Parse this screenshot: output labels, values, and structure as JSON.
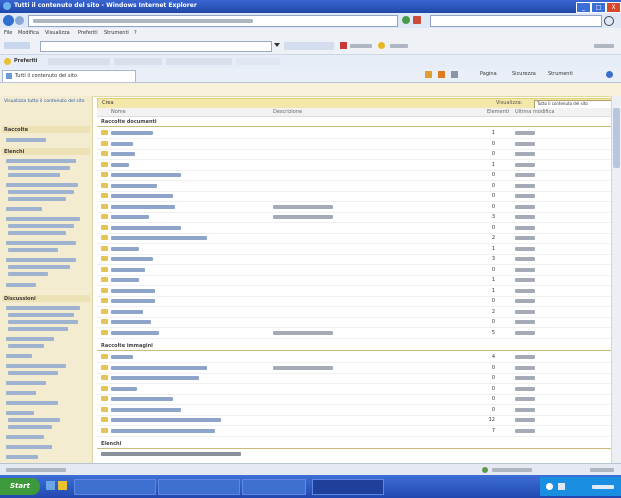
{
  "window": {
    "title": "Tutti il contenuto del sito - Windows Internet Explorer",
    "controls": [
      "_",
      "□",
      "X"
    ]
  },
  "menubar": {
    "items": [
      "File",
      "Modifica",
      "Visualizza",
      "Preferiti",
      "Strumenti",
      "?"
    ]
  },
  "toolbar": {
    "favorites_label": "Preferiti",
    "tab_label": "Tutti il contenuto del sito"
  },
  "command_bar": {
    "page_label": "Pagina",
    "safety_label": "Sicurezza",
    "tools_label": "Strumenti"
  },
  "sidebar": {
    "sections": [
      {
        "label": "Visualizza tutto il contenuto del sito"
      },
      {
        "label": "Raccolte"
      },
      {
        "label": "Elenchi"
      },
      {
        "label": "Discussioni"
      }
    ]
  },
  "content": {
    "header_left": "Crea",
    "header_view_label": "Visualizza:",
    "header_view_value": "Tutto il contenuto del sito",
    "columns": [
      "Nome",
      "Descrizione",
      "Elementi",
      "Ultima modifica"
    ],
    "group_documents": "Raccolte documenti",
    "group_images": "Raccolte immagini",
    "group_sites": "Elenchi",
    "documents": [
      {
        "count": "1",
        "ago": ""
      },
      {
        "count": "0",
        "ago": ""
      },
      {
        "count": "0",
        "ago": ""
      },
      {
        "count": "1",
        "ago": ""
      },
      {
        "count": "0",
        "ago": ""
      },
      {
        "count": "0",
        "ago": ""
      },
      {
        "count": "0",
        "ago": ""
      },
      {
        "count": "0",
        "ago": ""
      },
      {
        "count": "3",
        "ago": ""
      },
      {
        "count": "0",
        "ago": ""
      },
      {
        "count": "2",
        "ago": ""
      },
      {
        "count": "1",
        "ago": ""
      },
      {
        "count": "3",
        "ago": ""
      },
      {
        "count": "0",
        "ago": ""
      },
      {
        "count": "1",
        "ago": ""
      },
      {
        "count": "1",
        "ago": ""
      },
      {
        "count": "0",
        "ago": ""
      },
      {
        "count": "2",
        "ago": ""
      },
      {
        "count": "0",
        "ago": ""
      },
      {
        "count": "5",
        "ago": ""
      }
    ],
    "images": [
      {
        "count": "4",
        "ago": ""
      },
      {
        "count": "0",
        "ago": ""
      },
      {
        "count": "0",
        "ago": ""
      },
      {
        "count": "0",
        "ago": ""
      },
      {
        "count": "0",
        "ago": ""
      },
      {
        "count": "0",
        "ago": ""
      },
      {
        "count": "12",
        "ago": ""
      },
      {
        "count": "7",
        "ago": ""
      }
    ],
    "footer_text": ""
  },
  "statusbar": {
    "text": ""
  },
  "taskbar": {
    "start_label": "Start",
    "clock": ""
  },
  "colors": {
    "title_bar": "#1f47a8",
    "sidebar_bg": "#f2ecd4",
    "header_bg": "#f5eab0",
    "folder": "#e4c45a",
    "taskbar": "#2c55c2"
  }
}
